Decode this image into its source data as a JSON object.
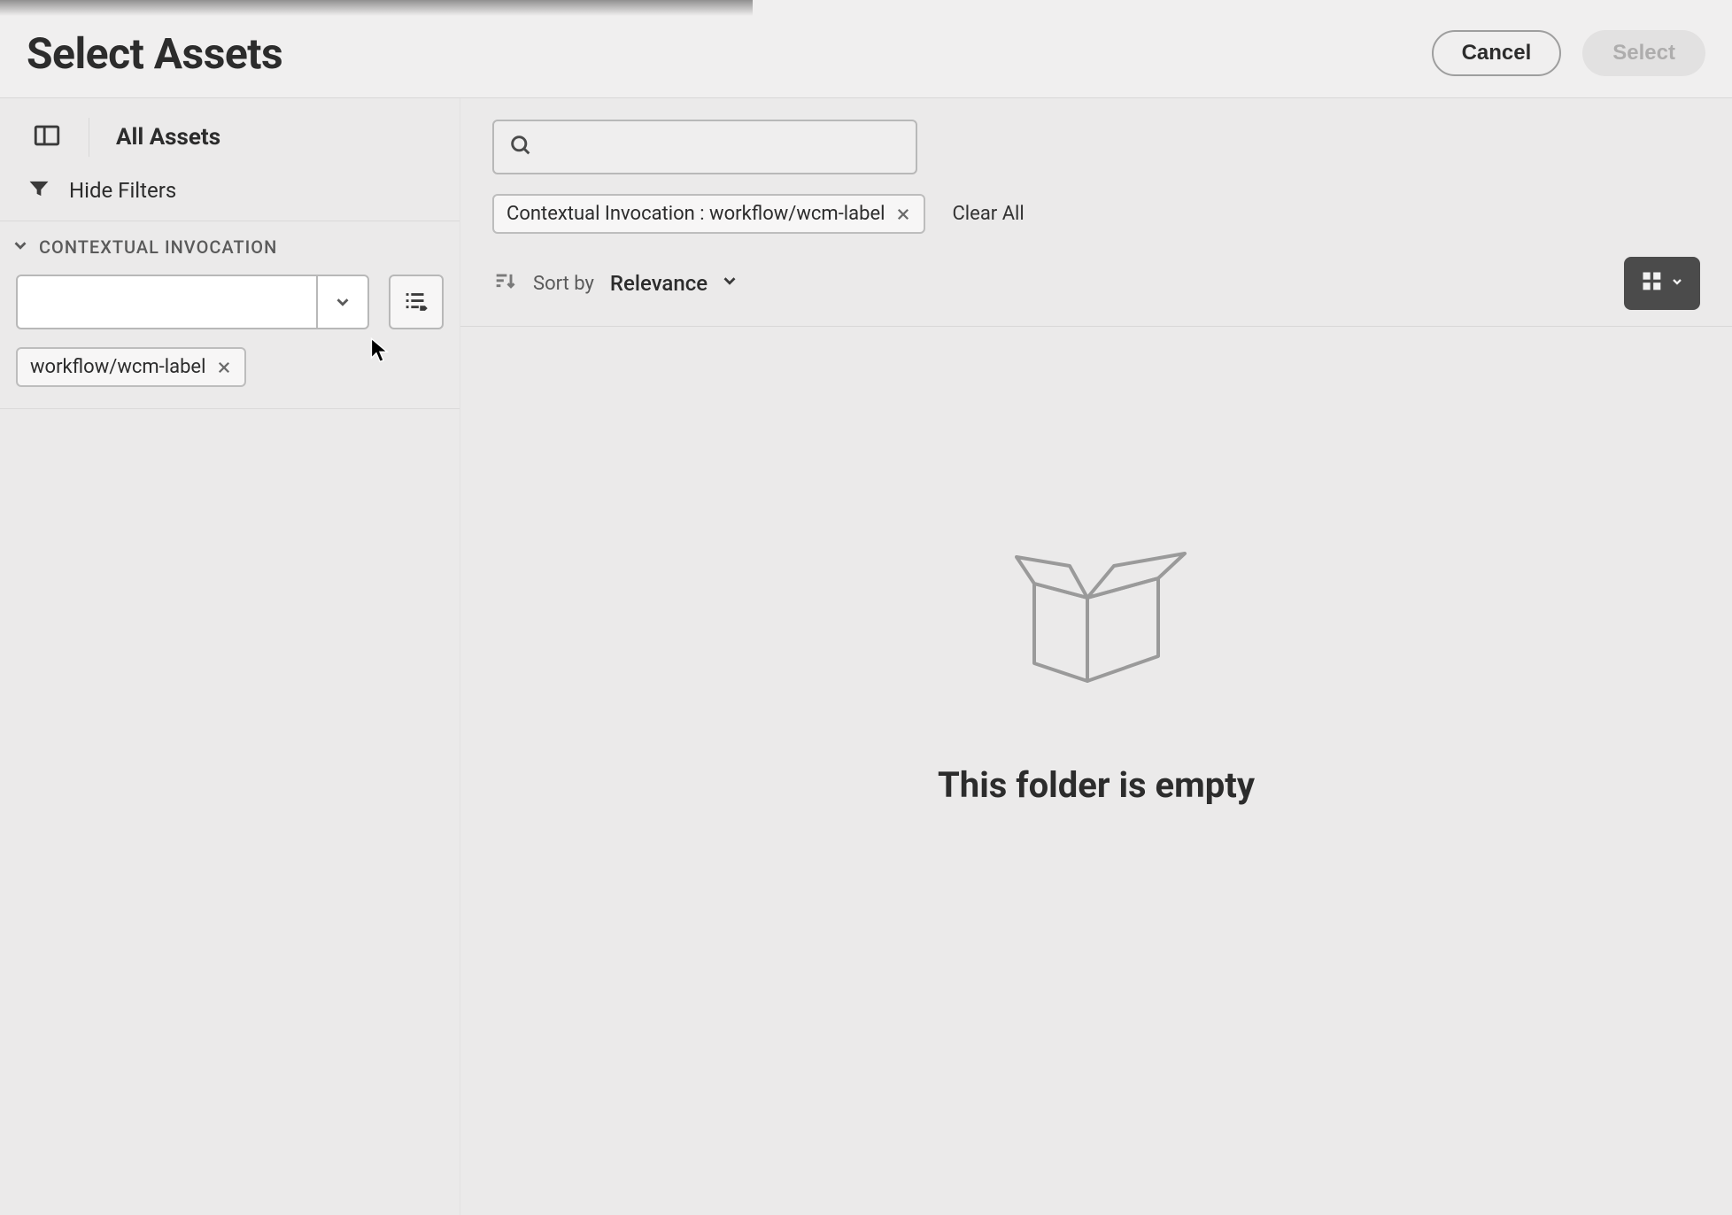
{
  "header": {
    "title": "Select Assets",
    "cancel_label": "Cancel",
    "select_label": "Select"
  },
  "sidebar": {
    "breadcrumb": "All Assets",
    "hide_filters_label": "Hide Filters",
    "filter": {
      "title": "CONTEXTUAL INVOCATION",
      "input_value": "",
      "tag_label": "workflow/wcm-label"
    }
  },
  "main": {
    "search_value": "",
    "chip_label": "Contextual Invocation : workflow/wcm-label",
    "clear_all_label": "Clear All",
    "sort_by_label": "Sort by",
    "sort_value": "Relevance",
    "empty_message": "This folder is empty"
  }
}
